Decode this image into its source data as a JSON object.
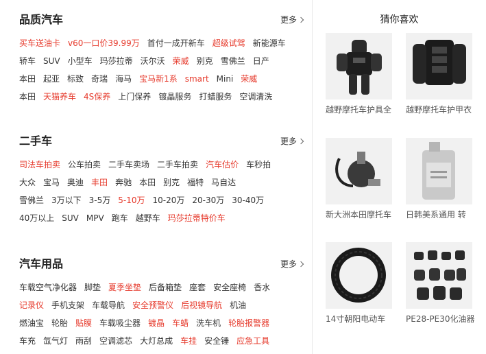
{
  "sections": [
    {
      "title": "品质汽车",
      "more": "更多",
      "rows": [
        [
          {
            "t": "买车送油卡",
            "red": true
          },
          {
            "t": "v60一口价39.99万",
            "red": true
          },
          {
            "t": "首付一成开新车",
            "red": false
          },
          {
            "t": "超级试驾",
            "red": true
          },
          {
            "t": "新能源车",
            "red": false
          }
        ],
        [
          {
            "t": "轿车",
            "red": false
          },
          {
            "t": "SUV",
            "red": false
          },
          {
            "t": "小型车",
            "red": false
          },
          {
            "t": "玛莎拉蒂",
            "red": false
          },
          {
            "t": "沃尔沃",
            "red": false
          },
          {
            "t": "荣威",
            "red": true
          },
          {
            "t": "别克",
            "red": false
          },
          {
            "t": "雪佛兰",
            "red": false
          },
          {
            "t": "日产",
            "red": false
          }
        ],
        [
          {
            "t": "本田",
            "red": false
          },
          {
            "t": "起亚",
            "red": false
          },
          {
            "t": "标致",
            "red": false
          },
          {
            "t": "奇瑞",
            "red": false
          },
          {
            "t": "海马",
            "red": false
          },
          {
            "t": "宝马新1系",
            "red": true
          },
          {
            "t": "smart",
            "red": true
          },
          {
            "t": "Mini",
            "red": false
          },
          {
            "t": "荣威",
            "red": true
          }
        ],
        [
          {
            "t": "本田",
            "red": false
          },
          {
            "t": "天猫养车",
            "red": true
          },
          {
            "t": "4S保养",
            "red": true
          },
          {
            "t": "上门保养",
            "red": false
          },
          {
            "t": "镀晶服务",
            "red": false
          },
          {
            "t": "打蜡服务",
            "red": false
          },
          {
            "t": "空调清洗",
            "red": false
          }
        ]
      ]
    },
    {
      "title": "二手车",
      "more": "更多",
      "rows": [
        [
          {
            "t": "司法车拍卖",
            "red": true
          },
          {
            "t": "公车拍卖",
            "red": false
          },
          {
            "t": "二手车卖场",
            "red": false
          },
          {
            "t": "二手车拍卖",
            "red": false
          },
          {
            "t": "汽车估价",
            "red": true
          },
          {
            "t": "车秒拍",
            "red": false
          }
        ],
        [
          {
            "t": "大众",
            "red": false
          },
          {
            "t": "宝马",
            "red": false
          },
          {
            "t": "奥迪",
            "red": false
          },
          {
            "t": "丰田",
            "red": true
          },
          {
            "t": "奔驰",
            "red": false
          },
          {
            "t": "本田",
            "red": false
          },
          {
            "t": "别克",
            "red": false
          },
          {
            "t": "福特",
            "red": false
          },
          {
            "t": "马自达",
            "red": false
          }
        ],
        [
          {
            "t": "雪佛兰",
            "red": false
          },
          {
            "t": "3万以下",
            "red": false
          },
          {
            "t": "3-5万",
            "red": false
          },
          {
            "t": "5-10万",
            "red": true
          },
          {
            "t": "10-20万",
            "red": false
          },
          {
            "t": "20-30万",
            "red": false
          },
          {
            "t": "30-40万",
            "red": false
          }
        ],
        [
          {
            "t": "40万以上",
            "red": false
          },
          {
            "t": "SUV",
            "red": false
          },
          {
            "t": "MPV",
            "red": false
          },
          {
            "t": "跑车",
            "red": false
          },
          {
            "t": "越野车",
            "red": false
          },
          {
            "t": "玛莎拉蒂特价车",
            "red": true
          }
        ]
      ]
    },
    {
      "title": "汽车用品",
      "more": "更多",
      "rows": [
        [
          {
            "t": "车载空气净化器",
            "red": false
          },
          {
            "t": "脚垫",
            "red": false
          },
          {
            "t": "夏季坐垫",
            "red": true
          },
          {
            "t": "后备箱垫",
            "red": false
          },
          {
            "t": "座套",
            "red": false
          },
          {
            "t": "安全座椅",
            "red": false
          },
          {
            "t": "香水",
            "red": false
          }
        ],
        [
          {
            "t": "记录仪",
            "red": true
          },
          {
            "t": "手机支架",
            "red": false
          },
          {
            "t": "车载导航",
            "red": false
          },
          {
            "t": "安全预警仪",
            "red": true
          },
          {
            "t": "后视镜导航",
            "red": true
          },
          {
            "t": "机油",
            "red": false
          }
        ],
        [
          {
            "t": "燃油宝",
            "red": false
          },
          {
            "t": "轮胎",
            "red": false
          },
          {
            "t": "贴膜",
            "red": true
          },
          {
            "t": "车载吸尘器",
            "red": false
          },
          {
            "t": "镀晶",
            "red": true
          },
          {
            "t": "车蜡",
            "red": true
          },
          {
            "t": "洗车机",
            "red": false
          },
          {
            "t": "轮胎报警器",
            "red": true
          }
        ],
        [
          {
            "t": "车充",
            "red": false
          },
          {
            "t": "氙气灯",
            "red": false
          },
          {
            "t": "雨刮",
            "red": false
          },
          {
            "t": "空调滤芯",
            "red": false
          },
          {
            "t": "大灯总成",
            "red": false
          },
          {
            "t": "车挂",
            "red": true
          },
          {
            "t": "安全锤",
            "red": false
          },
          {
            "t": "应急工具",
            "red": true
          }
        ]
      ]
    }
  ],
  "guess": {
    "title": "猜你喜欢",
    "items": [
      {
        "caption": "越野摩托车护具全",
        "icon": "armor-suit-icon"
      },
      {
        "caption": "越野摩托车护甲衣",
        "icon": "armor-jacket-icon"
      },
      {
        "caption": "新大洲本田摩托车",
        "icon": "carburetor-icon"
      },
      {
        "caption": "日韩美系通用 转",
        "icon": "oil-bottle-icon"
      },
      {
        "caption": "14寸朝阳电动车",
        "icon": "tire-icon"
      },
      {
        "caption": "PE28-PE30化油器",
        "icon": "carburetor-parts-icon"
      }
    ]
  },
  "colors": {
    "accent": "#e6392b",
    "text": "#333333",
    "divider": "#e8e8e8"
  }
}
